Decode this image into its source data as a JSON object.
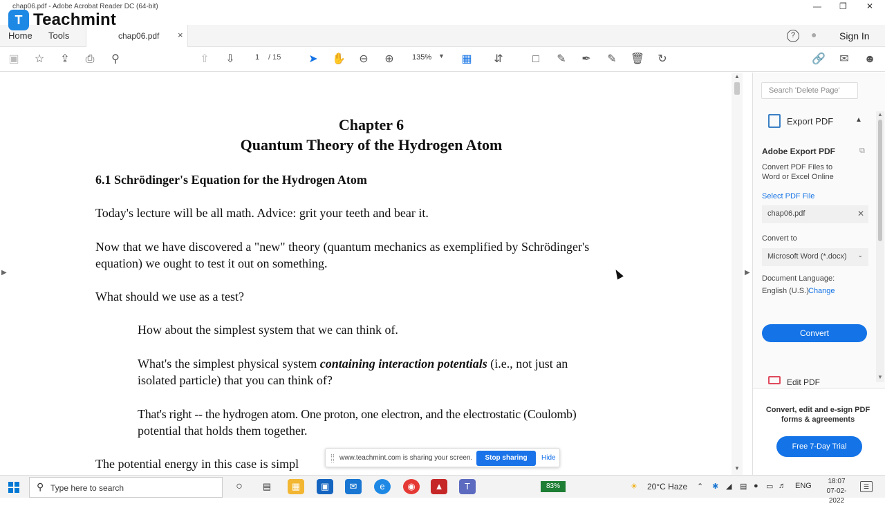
{
  "window": {
    "title": "chap06.pdf - Adobe Acrobat Reader DC (64-bit)",
    "minimize": "—",
    "restore": "❐",
    "close": "✕"
  },
  "overlay_logo": {
    "mark": "T",
    "name": "Teachmint"
  },
  "menu": {
    "home": "Home",
    "tools": "Tools",
    "doc_tab": "chap06.pdf",
    "doc_tab_close": "×",
    "help_icon": "?",
    "bell_icon": "🔔",
    "sign_in": "Sign In"
  },
  "toolbar": {
    "current_page": "1",
    "total_pages": "/ 15",
    "zoom": "135%",
    "icons": [
      "save-icon",
      "star-icon",
      "upload-icon",
      "print-icon",
      "search-icon",
      "page-up-icon",
      "page-down-icon",
      "select-cursor-icon",
      "hand-icon",
      "zoom-out-icon",
      "zoom-in-icon",
      "fit-page-icon",
      "scroll-mode-icon",
      "comment-icon",
      "pen-icon",
      "sign-icon",
      "fill-sign-icon",
      "delete-icon",
      "rotate-icon",
      "link-icon",
      "email-icon",
      "share-user-icon"
    ]
  },
  "document": {
    "chapter": "Chapter 6",
    "title": "Quantum Theory of the Hydrogen Atom",
    "section": "6.1  Schrödinger's Equation for the Hydrogen Atom",
    "p1": "Today's lecture will be all math.  Advice:  grit your teeth and bear it.",
    "p2_line1": "Now that we have discovered a \"new\" theory (quantum mechanics as exemplified by Schrödinger's",
    "p2_line2": "equation) we ought to test it out on something.",
    "p3": "What should we use as a test?",
    "p4": "How about the simplest system that we can think of.",
    "p5_line1_a": "What's the simplest physical system ",
    "p5_line1_em": "containing interaction potentials",
    "p5_line1_b": " (i.e., not just an",
    "p5_line2": "isolated particle) that you can think of?",
    "p6_line1": "That's right -- the hydrogen atom.  One proton, one electron, and the electrostatic (Coulomb)",
    "p6_line2": "potential that holds them together.",
    "p7": "The potential energy in this case is simpl"
  },
  "right_pane": {
    "search_placeholder": "Search 'Delete Page'",
    "export_title": "Export PDF",
    "adobe_export": "Adobe Export PDF",
    "description": "Convert PDF Files to Word or Excel Online",
    "select_file_label": "Select PDF File",
    "selected_file": "chap06.pdf",
    "convert_to_label": "Convert to",
    "convert_to_value": "Microsoft Word (*.docx)",
    "doc_lang_label": "Document Language:",
    "doc_lang_value": "English (U.S.)",
    "change": "Change",
    "convert_button": "Convert",
    "edit_pdf": "Edit PDF",
    "promo": "Convert, edit and e-sign PDF forms & agreements",
    "trial_button": "Free 7-Day Trial"
  },
  "share_bar": {
    "message": "www.teachmint.com is sharing your screen.",
    "stop": "Stop sharing",
    "hide": "Hide"
  },
  "taskbar": {
    "search_placeholder": "Type here to search",
    "battery": "83%",
    "weather": "20°C  Haze",
    "lang": "ENG",
    "time": "18:07",
    "date": "07-02-2022"
  },
  "colors": {
    "accent_blue": "#1473e6",
    "share_blue": "#1a73e8",
    "teachmint_blue": "#1e88e5",
    "battery_green": "#1e7e34"
  }
}
